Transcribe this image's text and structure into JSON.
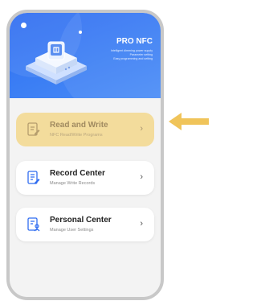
{
  "app": {
    "title": "PRO NFC",
    "features": [
      "Intelligent dimming power supply",
      "Parameter setting",
      "Easy programming and setting"
    ]
  },
  "menu": [
    {
      "title": "Read and Write",
      "subtitle": "NFC Read/Write Programs",
      "icon": "edit-document-icon",
      "highlighted": true
    },
    {
      "title": "Record Center",
      "subtitle": "Manage Write Records",
      "icon": "records-icon",
      "highlighted": false
    },
    {
      "title": "Personal Center",
      "subtitle": "Manage User Settings",
      "icon": "user-settings-icon",
      "highlighted": false
    }
  ],
  "chevron": "›",
  "colors": {
    "hero_blue": "#3b7ef4",
    "highlight": "#f3dc9c",
    "arrow": "#f0c45a",
    "icon_blue": "#2f6cf0"
  },
  "icons": {
    "pointer": "left-arrow-icon"
  }
}
